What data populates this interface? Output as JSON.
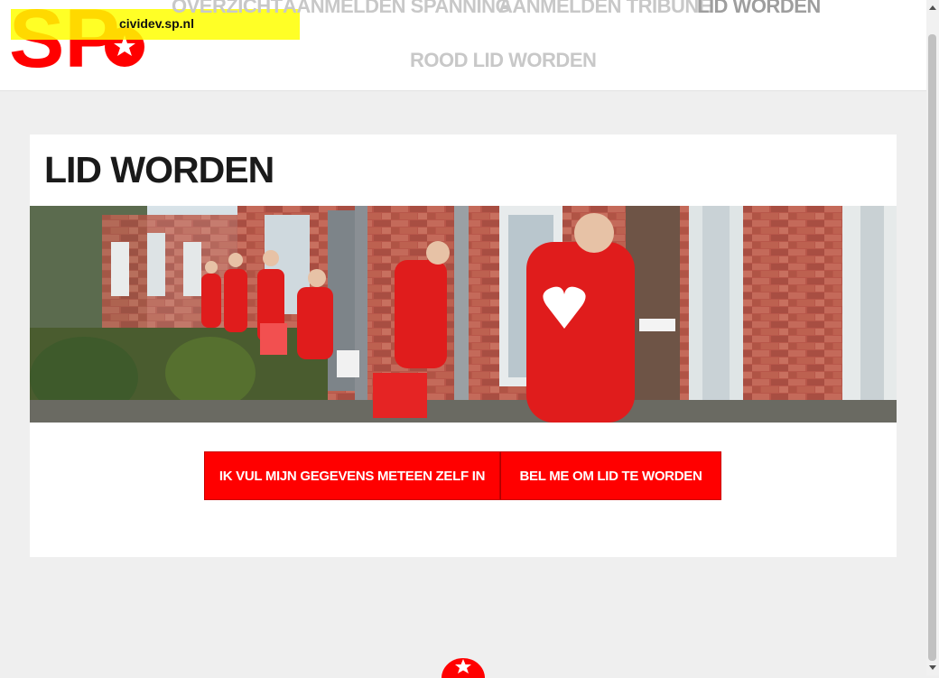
{
  "header": {
    "logo_alt": "SP",
    "env_badge": "cividev.sp.nl",
    "nav": [
      {
        "label": "OVERZICHT",
        "active": false
      },
      {
        "label": "AANMELDEN SPANNING",
        "active": false
      },
      {
        "label": "AANMELDEN TRIBUNE",
        "active": false
      },
      {
        "label": "LID WORDEN",
        "active": true
      },
      {
        "label": "ROOD LID WORDEN",
        "active": false
      }
    ]
  },
  "main": {
    "title": "LID WORDEN",
    "hero_image": "canvassing-photo",
    "buttons": {
      "fill_in": "IK VUL MIJN GEGEVENS METEEN ZELF IN",
      "call_me": "BEL ME OM LID TE WORDEN"
    }
  },
  "colors": {
    "brand_red": "#ff0000",
    "badge_yellow": "#ffff00",
    "background": "#efefef"
  }
}
